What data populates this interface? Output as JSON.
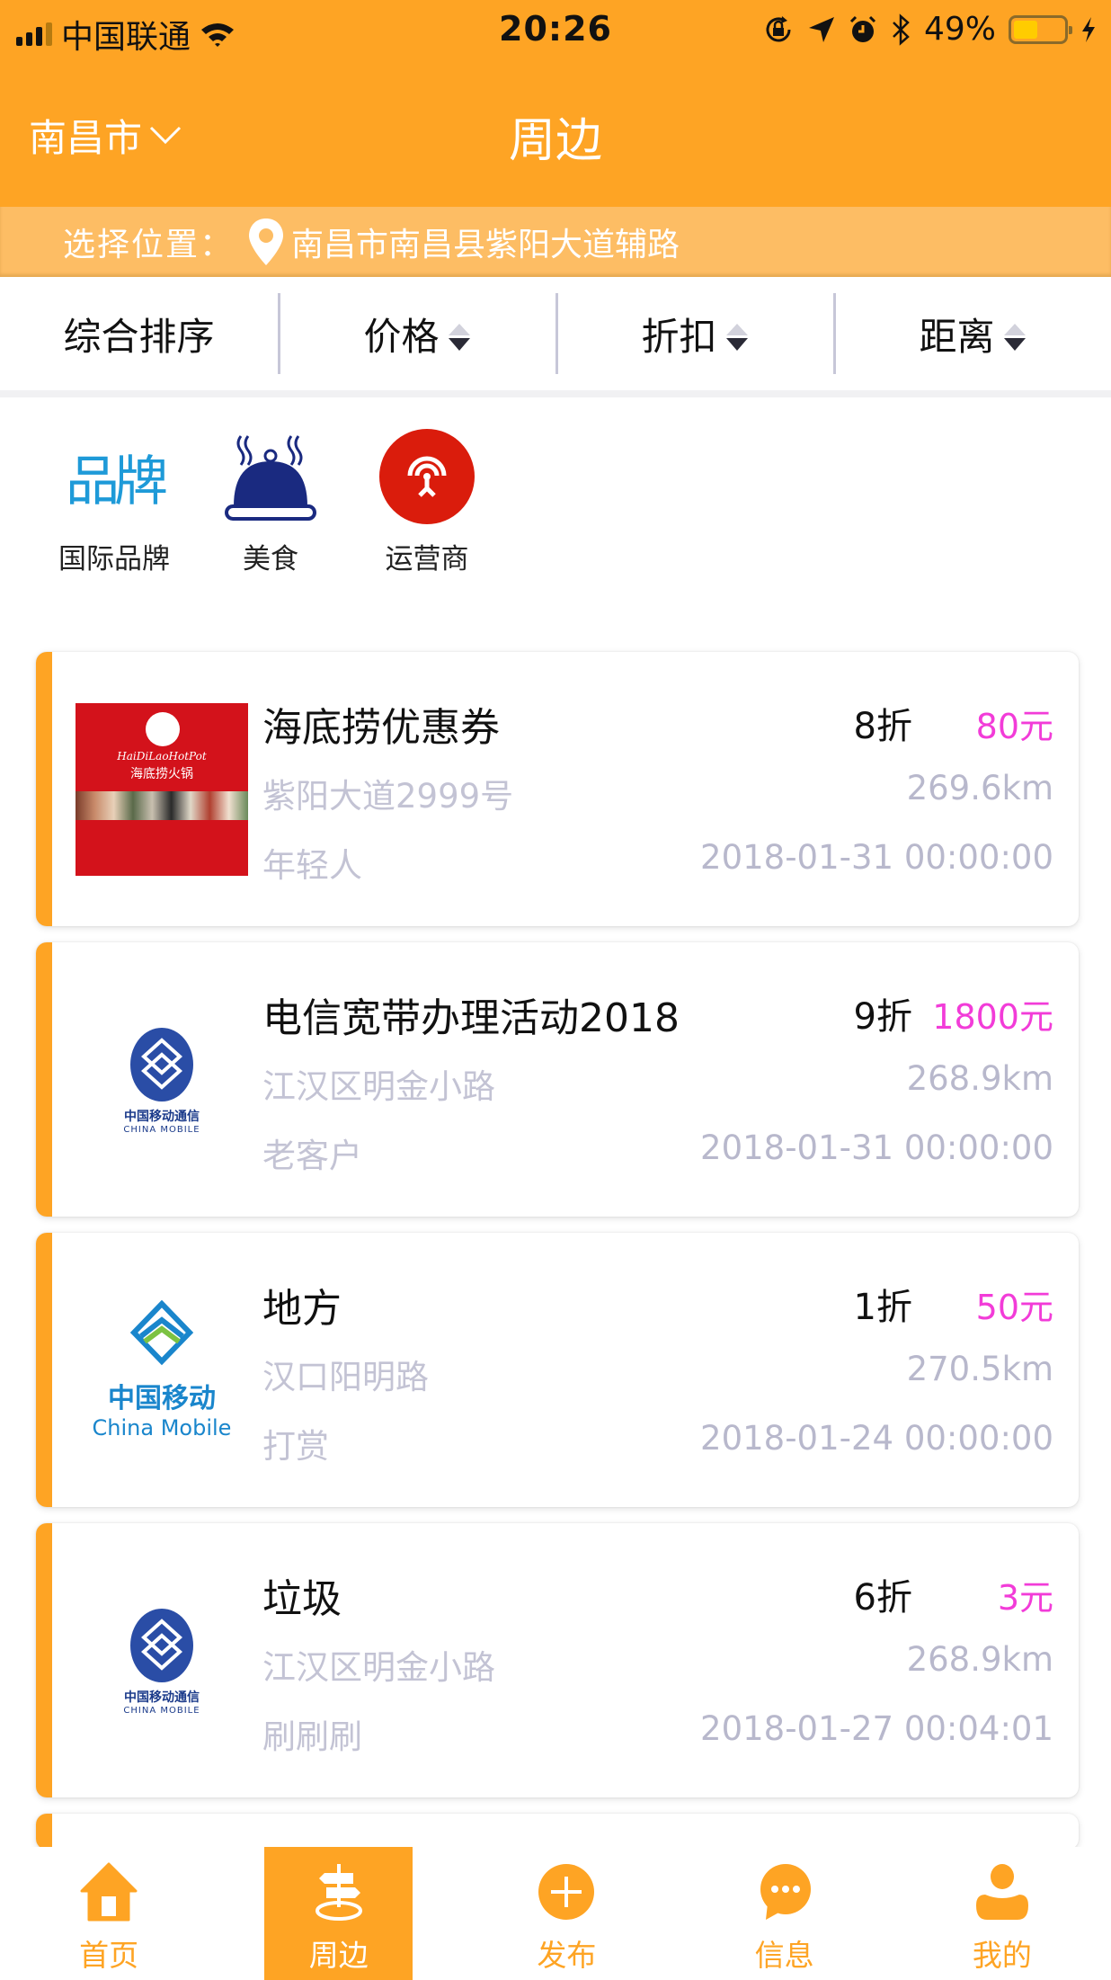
{
  "status_bar": {
    "carrier": "中国联通",
    "time": "20:26",
    "battery_percent": "49%",
    "battery_level": 0.49
  },
  "nav": {
    "city": "南昌市",
    "title": "周边"
  },
  "location": {
    "label": "选择位置：",
    "address": "南昌市南昌县紫阳大道辅路"
  },
  "sort": [
    {
      "label": "综合排序",
      "has_arrows": false
    },
    {
      "label": "价格",
      "has_arrows": true
    },
    {
      "label": "折扣",
      "has_arrows": true
    },
    {
      "label": "距离",
      "has_arrows": true
    }
  ],
  "categories": [
    {
      "label": "国际品牌",
      "icon": "brand-icon",
      "icon_text": "品牌"
    },
    {
      "label": "美食",
      "icon": "food-cloche-icon"
    },
    {
      "label": "运营商",
      "icon": "carrier-signal-icon"
    }
  ],
  "colors": {
    "accent": "#fea424",
    "price": "#f23cd8",
    "muted": "#c3c3d4"
  },
  "listings": [
    {
      "title": "海底捞优惠券",
      "discount": "8折",
      "price": "80元",
      "address": "紫阳大道2999号",
      "distance": "269.6km",
      "tag": "年轻人",
      "date": "2018-01-31 00:00:00",
      "thumb": "haidilao",
      "thumb_en": "HaiDiLaoHotPot",
      "thumb_cn": "海底捞火锅"
    },
    {
      "title": "电信宽带办理活动2018",
      "discount": "9折",
      "price": "1800元",
      "address": "江汉区明金小路",
      "distance": "268.9km",
      "tag": "老客户",
      "date": "2018-01-31 00:00:00",
      "thumb": "china-mobile-old",
      "thumb_cn": "中国移动通信",
      "thumb_en": "CHINA MOBILE"
    },
    {
      "title": "地方",
      "discount": "1折",
      "price": "50元",
      "address": "汉口阳明路",
      "distance": "270.5km",
      "tag": "打赏",
      "date": "2018-01-24 00:00:00",
      "thumb": "china-mobile-new",
      "thumb_cn": "中国移动",
      "thumb_en": "China Mobile"
    },
    {
      "title": "垃圾",
      "discount": "6折",
      "price": "3元",
      "address": "江汉区明金小路",
      "distance": "268.9km",
      "tag": "刷刷刷",
      "date": "2018-01-27 00:04:01",
      "thumb": "china-mobile-old",
      "thumb_cn": "中国移动通信",
      "thumb_en": "CHINA MOBILE"
    }
  ],
  "tabs": [
    {
      "label": "首页",
      "icon": "home-icon",
      "active": false
    },
    {
      "label": "周边",
      "icon": "signpost-icon",
      "active": true
    },
    {
      "label": "发布",
      "icon": "plus-circle-icon",
      "active": false
    },
    {
      "label": "信息",
      "icon": "chat-bubble-icon",
      "active": false
    },
    {
      "label": "我的",
      "icon": "user-icon",
      "active": false
    }
  ]
}
